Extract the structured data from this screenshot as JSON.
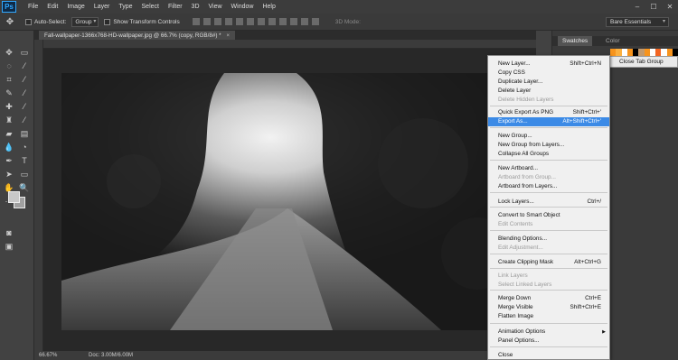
{
  "app": {
    "logo": "Ps"
  },
  "menubar": {
    "items": [
      "File",
      "Edit",
      "Image",
      "Layer",
      "Type",
      "Select",
      "Filter",
      "3D",
      "View",
      "Window",
      "Help"
    ]
  },
  "window_controls": {
    "minimize": "–",
    "maximize": "☐",
    "close": "✕"
  },
  "options": {
    "auto_select_label": "Auto-Select:",
    "auto_select_value": "Group",
    "transform_label": "Show Transform Controls",
    "mode_3d": "3D Mode:",
    "workspace": "Bare Essentials"
  },
  "document": {
    "tab_title": "Fall-wallpaper-1366x768-HD-wallpaper.jpg @ 66.7% (copy, RGB/8#) *",
    "tab_close": "×"
  },
  "status": {
    "zoom": "66.67%",
    "doc_size": "Doc: 3.00M/6.00M"
  },
  "panels": {
    "tabs": [
      "Swatches",
      "Color"
    ],
    "active_tab": "Swatches",
    "flyout_label": "Close Tab Group"
  },
  "swatch_colors": [
    "#f7941d",
    "#fbb040",
    "#ffffff",
    "#f7941d",
    "#000000",
    "#c49a6c",
    "#f7941d",
    "#ffffff",
    "#f26522",
    "#ffffff",
    "#f7941d",
    "#000000"
  ],
  "context_menu": {
    "highlight_color": "#3b8ae6",
    "items": [
      {
        "label": "New Layer...",
        "shortcut": "Shift+Ctrl+N",
        "disabled": false
      },
      {
        "label": "Copy CSS",
        "shortcut": "",
        "disabled": false
      },
      {
        "label": "Duplicate Layer...",
        "shortcut": "",
        "disabled": false
      },
      {
        "label": "Delete Layer",
        "shortcut": "",
        "disabled": false
      },
      {
        "label": "Delete Hidden Layers",
        "shortcut": "",
        "disabled": true
      },
      {
        "label": "Quick Export As PNG",
        "shortcut": "Shift+Ctrl+'",
        "disabled": false
      },
      {
        "label": "Export As...",
        "shortcut": "Alt+Shift+Ctrl+'",
        "disabled": false,
        "highlighted": true
      },
      {
        "label": "New Group...",
        "shortcut": "",
        "disabled": false
      },
      {
        "label": "New Group from Layers...",
        "shortcut": "",
        "disabled": false
      },
      {
        "label": "Collapse All Groups",
        "shortcut": "",
        "disabled": false
      },
      {
        "label": "New Artboard...",
        "shortcut": "",
        "disabled": false
      },
      {
        "label": "Artboard from Group...",
        "shortcut": "",
        "disabled": true
      },
      {
        "label": "Artboard from Layers...",
        "shortcut": "",
        "disabled": false
      },
      {
        "label": "Lock Layers...",
        "shortcut": "Ctrl+/",
        "disabled": false
      },
      {
        "label": "Convert to Smart Object",
        "shortcut": "",
        "disabled": false
      },
      {
        "label": "Edit Contents",
        "shortcut": "",
        "disabled": true
      },
      {
        "label": "Blending Options...",
        "shortcut": "",
        "disabled": false
      },
      {
        "label": "Edit Adjustment...",
        "shortcut": "",
        "disabled": true
      },
      {
        "label": "Create Clipping Mask",
        "shortcut": "Alt+Ctrl+G",
        "disabled": false
      },
      {
        "label": "Link Layers",
        "shortcut": "",
        "disabled": true
      },
      {
        "label": "Select Linked Layers",
        "shortcut": "",
        "disabled": true
      },
      {
        "label": "Merge Down",
        "shortcut": "Ctrl+E",
        "disabled": false
      },
      {
        "label": "Merge Visible",
        "shortcut": "Shift+Ctrl+E",
        "disabled": false
      },
      {
        "label": "Flatten Image",
        "shortcut": "",
        "disabled": false
      },
      {
        "label": "Animation Options",
        "shortcut": "",
        "disabled": false,
        "submenu": true
      },
      {
        "label": "Panel Options...",
        "shortcut": "",
        "disabled": false
      },
      {
        "label": "Close",
        "shortcut": "",
        "disabled": false
      }
    ]
  }
}
